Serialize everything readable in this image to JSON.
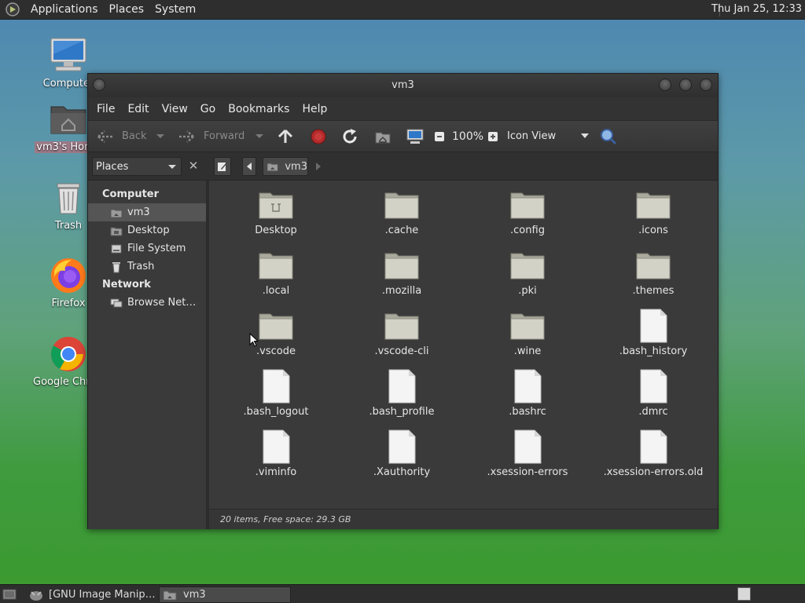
{
  "top_panel": {
    "menus": [
      "Applications",
      "Places",
      "System"
    ],
    "clock": "Thu Jan 25, 12:33"
  },
  "desktop_icons": [
    {
      "label": "Computer",
      "icon": "computer-icon"
    },
    {
      "label": "vm3's Home",
      "icon": "home-folder-icon"
    },
    {
      "label": "Trash",
      "icon": "trash-icon"
    },
    {
      "label": "Firefox",
      "icon": "firefox-icon"
    },
    {
      "label": "Google Chrome",
      "icon": "chrome-icon"
    }
  ],
  "window": {
    "title": "vm3",
    "menubar": [
      "File",
      "Edit",
      "View",
      "Go",
      "Bookmarks",
      "Help"
    ],
    "toolbar": {
      "back": "Back",
      "forward": "Forward",
      "zoom": "100%",
      "view_mode": "Icon View"
    },
    "pathbar": {
      "places_label": "Places",
      "current": "vm3"
    },
    "sidebar": {
      "sections": [
        {
          "heading": "Computer",
          "items": [
            {
              "label": "vm3",
              "icon": "home-icon",
              "selected": true
            },
            {
              "label": "Desktop",
              "icon": "desktop-folder-icon"
            },
            {
              "label": "File System",
              "icon": "drive-icon"
            },
            {
              "label": "Trash",
              "icon": "trash-icon"
            }
          ]
        },
        {
          "heading": "Network",
          "items": [
            {
              "label": "Browse Net…",
              "icon": "network-icon"
            }
          ]
        }
      ]
    },
    "files": [
      {
        "name": "Desktop",
        "type": "desktop-folder"
      },
      {
        "name": ".cache",
        "type": "folder"
      },
      {
        "name": ".config",
        "type": "folder"
      },
      {
        "name": ".icons",
        "type": "folder"
      },
      {
        "name": ".local",
        "type": "folder"
      },
      {
        "name": ".mozilla",
        "type": "folder"
      },
      {
        "name": ".pki",
        "type": "folder"
      },
      {
        "name": ".themes",
        "type": "folder"
      },
      {
        "name": ".vscode",
        "type": "folder"
      },
      {
        "name": ".vscode-cli",
        "type": "folder"
      },
      {
        "name": ".wine",
        "type": "folder"
      },
      {
        "name": ".bash_history",
        "type": "file"
      },
      {
        "name": ".bash_logout",
        "type": "file"
      },
      {
        "name": ".bash_profile",
        "type": "file"
      },
      {
        "name": ".bashrc",
        "type": "file"
      },
      {
        "name": ".dmrc",
        "type": "file"
      },
      {
        "name": ".viminfo",
        "type": "file"
      },
      {
        "name": ".Xauthority",
        "type": "file"
      },
      {
        "name": ".xsession-errors",
        "type": "file"
      },
      {
        "name": ".xsession-errors.old",
        "type": "file"
      }
    ],
    "status": "20 items, Free space: 29.3 GB"
  },
  "taskbar": {
    "tasks": [
      {
        "label": "[GNU Image Manip…",
        "icon": "gimp-icon",
        "active": false
      },
      {
        "label": "vm3",
        "icon": "folder-icon",
        "active": true
      }
    ]
  }
}
